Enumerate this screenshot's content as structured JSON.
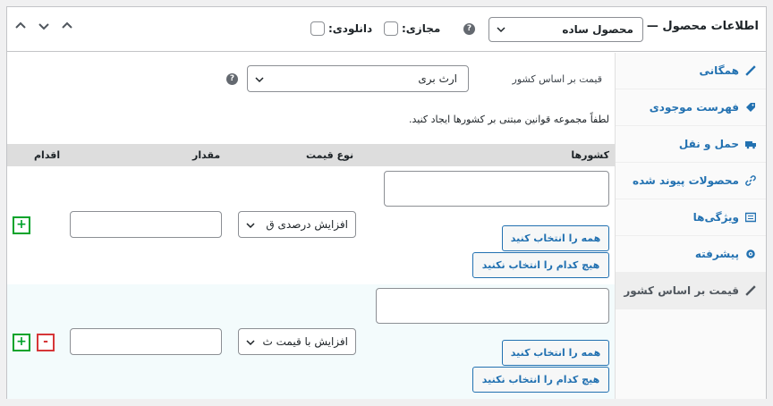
{
  "header": {
    "title": "اطلاعات محصول —",
    "product_type": "محصول ساده",
    "virtual_label": "مجازی:",
    "downloadable_label": "دانلودی:",
    "help_glyph": "?"
  },
  "tabs": [
    {
      "label": "همگانی",
      "icon": "wrench-icon"
    },
    {
      "label": "فهرست موجودی",
      "icon": "tag-icon"
    },
    {
      "label": "حمل و نقل",
      "icon": "truck-icon"
    },
    {
      "label": "محصولات پیوند شده",
      "icon": "link-icon"
    },
    {
      "label": "ویژگی‌ها",
      "icon": "list-icon"
    },
    {
      "label": "پیشرفته",
      "icon": "gear-icon"
    },
    {
      "label": "قیمت بر اساس کشور",
      "icon": "wrench-icon",
      "active": true
    }
  ],
  "main": {
    "country_price_label": "قیمت بر اساس کشور",
    "currency_value": "ارث بری",
    "note": "لطفاً مجموعه قوانین مبتنی بر کشورها ایجاد کنید.",
    "columns": [
      "کشورها",
      "نوع قیمت",
      "مقدار",
      "اقدام"
    ],
    "select_all": "همه را انتخاب کنید",
    "select_none": "هیچ کدام را انتخاب نکنید",
    "rows": [
      {
        "price_type": "افزایش درصدی ق",
        "amount": "",
        "countries": ""
      },
      {
        "price_type": "افزایش با قیمت ث",
        "amount": "",
        "countries": ""
      }
    ],
    "add_glyph": "+",
    "remove_glyph": "-"
  }
}
